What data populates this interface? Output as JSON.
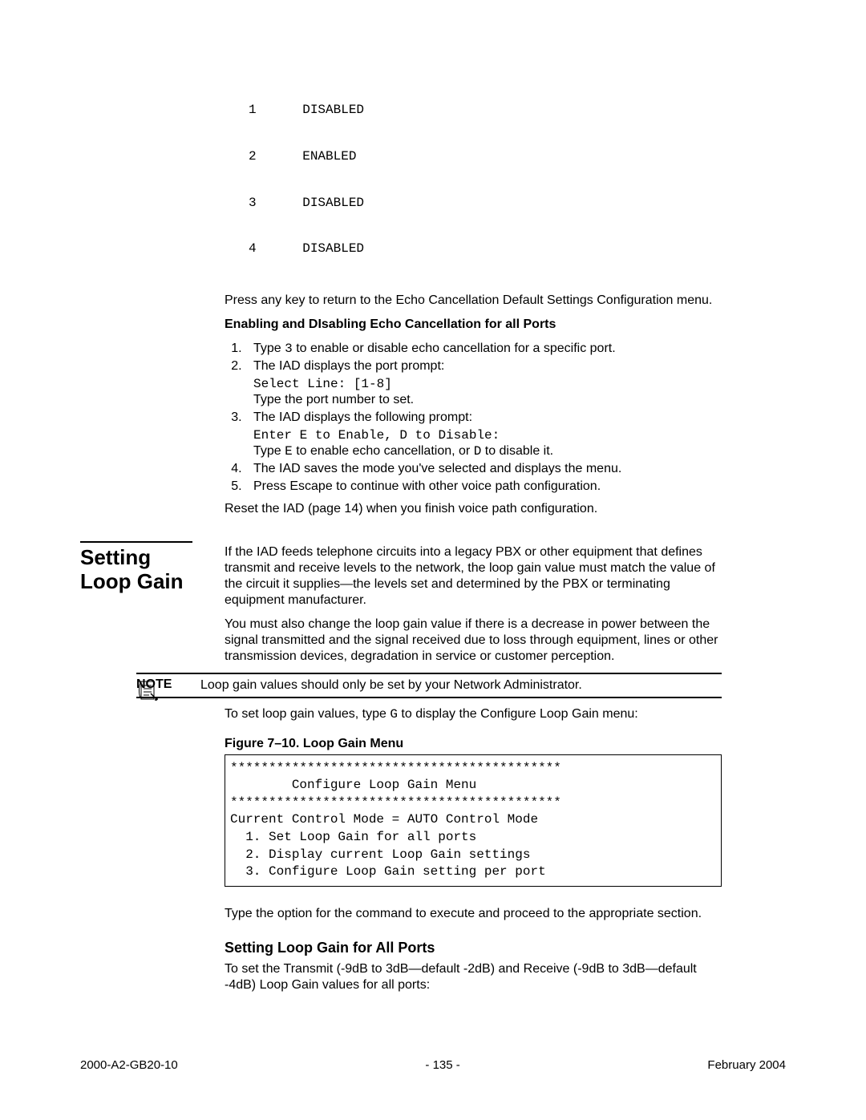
{
  "port_table": [
    {
      "n": "1",
      "state": "DISABLED"
    },
    {
      "n": "2",
      "state": "ENABLED"
    },
    {
      "n": "3",
      "state": "DISABLED"
    },
    {
      "n": "4",
      "state": "DISABLED"
    }
  ],
  "p_return": "Press any key to return to the Echo Cancellation Default Settings Configuration menu.",
  "h_enable_disable": "Enabling and DIsabling Echo Cancellation for all Ports",
  "steps": {
    "s1_a": "Type ",
    "s1_b": "3",
    "s1_c": " to enable or disable echo cancellation for a specific port.",
    "s2": "The IAD displays the port prompt:",
    "s2_code": "Select Line: [1-8]",
    "s2_after": "Type the port number to set.",
    "s3": "The IAD displays the following prompt:",
    "s3_code": "Enter E to Enable, D to Disable:",
    "s3_after_a": "Type ",
    "s3_after_b": "E",
    "s3_after_c": " to enable echo cancellation, or ",
    "s3_after_d": "D",
    "s3_after_e": " to disable it.",
    "s4": "The IAD saves the mode you've selected and displays the menu.",
    "s5": "Press Escape to continue with other voice path configuration."
  },
  "reset_line": "Reset the IAD (page 14) when you finish voice path configuration.",
  "section_title_1": "Setting",
  "section_title_2": "Loop Gain",
  "loop_intro_1": "If the IAD feeds telephone circuits into a legacy PBX or other equipment that defines transmit and receive levels to the network, the loop gain value must match the value of the circuit it supplies—the levels set and determined by the PBX or terminating equipment manufacturer.",
  "loop_intro_2": "You must also change the loop gain value if there is a decrease in power between the signal transmitted and the signal received due to loss through equipment, lines or other transmission devices, degradation in service or customer perception.",
  "note_label": "NOTE",
  "note_text": "Loop gain values should only be set by your Network Administrator.",
  "loop_set_a": "To set loop gain values, type ",
  "loop_set_b": "G",
  "loop_set_c": " to display the Configure Loop Gain menu:",
  "figure_caption": "Figure 7–10.  Loop Gain Menu",
  "code_box": "*******************************************\n        Configure Loop Gain Menu\n*******************************************\nCurrent Control Mode = AUTO Control Mode\n  1. Set Loop Gain for all ports\n  2. Display current Loop Gain settings\n  3. Configure Loop Gain setting per port",
  "p_option": "Type the option for the command to execute and proceed to the appropriate section.",
  "h_all_ports": "Setting Loop Gain for All Ports",
  "p_all_ports": "To set the Transmit (-9dB to 3dB—default -2dB) and Receive (-9dB to 3dB—default -4dB) Loop Gain values for all ports:",
  "footer": {
    "left": "2000-A2-GB20-10",
    "center": "- 135 -",
    "right": "February 2004"
  }
}
